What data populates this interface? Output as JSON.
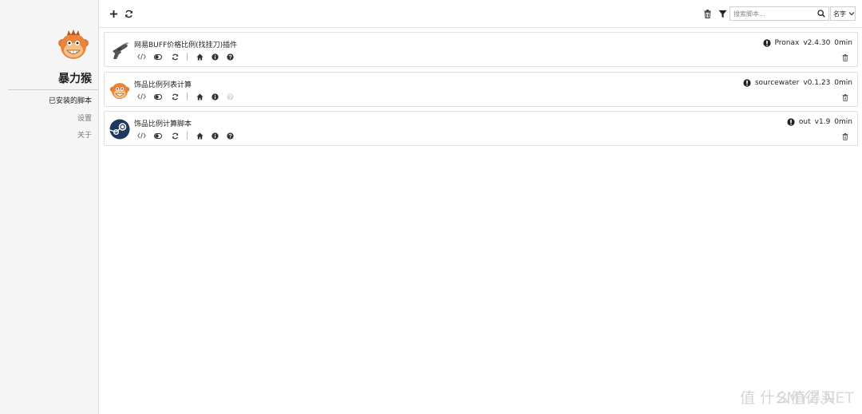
{
  "sidebar": {
    "app_name": "暴力猴",
    "logo_icon": "violentmonkey-logo",
    "items": [
      {
        "label": "已安装的脚本",
        "active": true
      },
      {
        "label": "设置",
        "active": false
      },
      {
        "label": "关于",
        "active": false
      }
    ]
  },
  "toolbar": {
    "new_icon": "plus-icon",
    "update_all_icon": "refresh-icon",
    "trash_icon": "trash-icon",
    "filter_icon": "filter-icon",
    "search": {
      "placeholder": "搜索脚本...",
      "value": ""
    },
    "sort": {
      "selected": "名字"
    }
  },
  "scripts": [
    {
      "name": "网易BUFF价格比例(找挂刀)插件",
      "author": "Pronax",
      "version": "v2.4.30",
      "updated": "0min",
      "icon": "gun-icon",
      "support_enabled": true
    },
    {
      "name": "饰品比例列表计算",
      "author": "sourcewater",
      "version": "v0.1.23",
      "updated": "0min",
      "icon": "monkey-icon",
      "support_enabled": false
    },
    {
      "name": "饰品比例计算脚本",
      "author": "out",
      "version": "v1.9",
      "updated": "0min",
      "icon": "steam-icon",
      "support_enabled": true
    }
  ],
  "watermark": {
    "text": "值 什么值得买",
    "overlay": "SMYZ.NET"
  },
  "colors": {
    "sidebar_bg": "#f5f5f5",
    "border": "#e0e0e0",
    "icon": "#333333",
    "disabled": "#d8d8d8"
  }
}
